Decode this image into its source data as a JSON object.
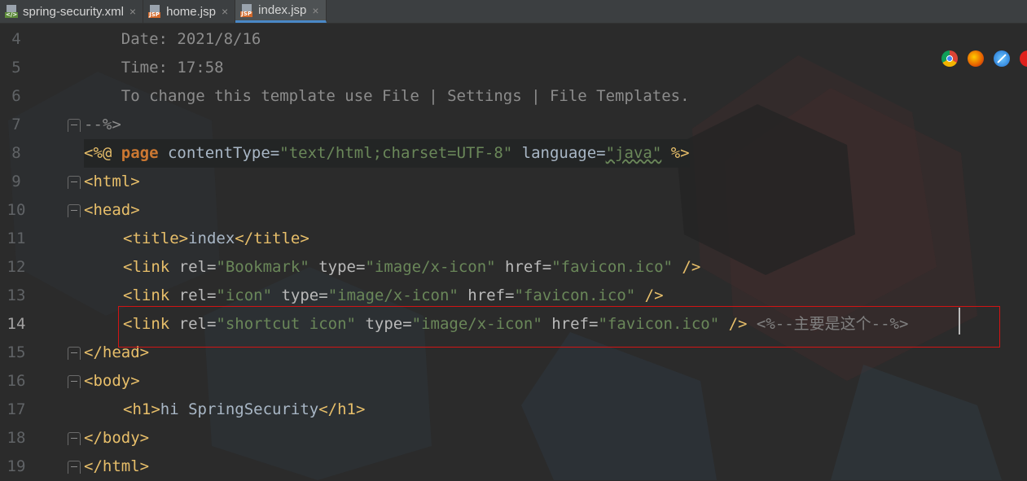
{
  "tabs": [
    {
      "label": "spring-security.xml",
      "icon": "xml-file-icon",
      "icon_badge": "</>",
      "active": false
    },
    {
      "label": "home.jsp",
      "icon": "jsp-file-icon",
      "icon_badge": "JSP",
      "active": false
    },
    {
      "label": "index.jsp",
      "icon": "jsp-file-icon",
      "icon_badge": "JSP",
      "active": true
    }
  ],
  "close_glyph": "×",
  "browser_icons": [
    "chrome-icon",
    "firefox-icon",
    "safari-icon",
    "opera-icon"
  ],
  "current_line": "14",
  "lines": [
    {
      "num": "4",
      "text": "    Date: 2021/8/16"
    },
    {
      "num": "5",
      "text": "    Time: 17:58"
    },
    {
      "num": "6",
      "text": "    To change this template use File | Settings | File Templates."
    },
    {
      "num": "7",
      "text": "--%>"
    },
    {
      "num": "8",
      "parts": {
        "open": "<%@ ",
        "kw": "page",
        "a1": " contentType=",
        "v1": "\"text/html;charset=UTF-8\"",
        "a2": " language=",
        "v2": "\"java\"",
        "close": " %>"
      }
    },
    {
      "num": "9",
      "text": "<html>"
    },
    {
      "num": "10",
      "text": "<head>"
    },
    {
      "num": "11",
      "parts": {
        "open": "<title>",
        "body": "index",
        "close": "</title>"
      }
    },
    {
      "num": "12",
      "parts": {
        "tag": "<link ",
        "a1": "rel=",
        "v1": "\"Bookmark\"",
        "a2": " type=",
        "v2": "\"image/x-icon\"",
        "a3": " href=",
        "v3": "\"favicon.ico\"",
        "close": " />"
      }
    },
    {
      "num": "13",
      "parts": {
        "tag": "<link ",
        "a1": "rel=",
        "v1": "\"icon\"",
        "a2": " type=",
        "v2": "\"image/x-icon\"",
        "a3": " href=",
        "v3": "\"favicon.ico\"",
        "close": " />"
      }
    },
    {
      "num": "14",
      "parts": {
        "tag": "<link ",
        "a1": "rel=",
        "v1": "\"shortcut icon\"",
        "a2": " type=",
        "v2": "\"image/x-icon\"",
        "a3": " href=",
        "v3": "\"favicon.ico\"",
        "close": " />",
        "comment": " <%--主要是这个--%>"
      }
    },
    {
      "num": "15",
      "text": "</head>"
    },
    {
      "num": "16",
      "text": "<body>"
    },
    {
      "num": "17",
      "parts": {
        "open": "<h1>",
        "body": "hi SpringSecurity",
        "close": "</h1>"
      }
    },
    {
      "num": "18",
      "text": "</body>"
    },
    {
      "num": "19",
      "text": "</html>"
    }
  ],
  "colors": {
    "background": "#2b2b2b",
    "tag": "#e8bf6a",
    "string": "#6a8759",
    "keyword": "#cc7832",
    "comment": "#8c8c8c",
    "highlight_box": "#d21414",
    "active_tab_underline": "#4a88c7"
  }
}
